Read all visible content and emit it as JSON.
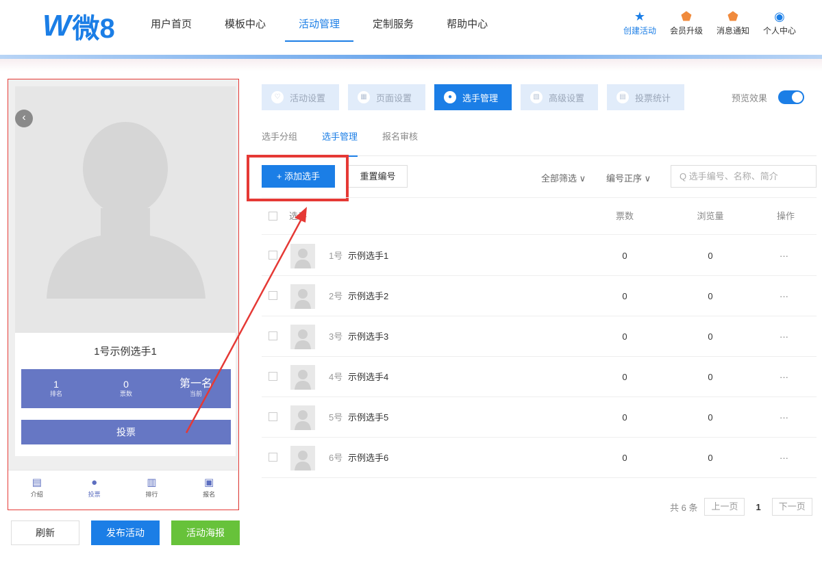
{
  "header": {
    "logo_w": "W",
    "logo_text": "微8",
    "nav": [
      {
        "label": "用户首页"
      },
      {
        "label": "模板中心"
      },
      {
        "label": "活动管理",
        "active": true
      },
      {
        "label": "定制服务"
      },
      {
        "label": "帮助中心"
      }
    ],
    "right": [
      {
        "label": "创建活动",
        "icon": "star-icon"
      },
      {
        "label": "会员升级",
        "icon": "crown-badge-icon"
      },
      {
        "label": "消息通知",
        "icon": "bell-badge-icon"
      },
      {
        "label": "个人中心",
        "icon": "user-circle-icon"
      }
    ]
  },
  "preview": {
    "player_name": "1号示例选手1",
    "stats": [
      {
        "value": "1",
        "label": "排名"
      },
      {
        "value": "0",
        "label": "票数"
      },
      {
        "value": "第一名",
        "label": "当前"
      }
    ],
    "vote_label": "投票",
    "tabs": [
      {
        "label": "介绍",
        "icon": "doc-icon"
      },
      {
        "label": "投票",
        "icon": "person-icon"
      },
      {
        "label": "排行",
        "icon": "bar-chart-icon"
      },
      {
        "label": "报名",
        "icon": "id-card-icon"
      }
    ]
  },
  "bottom_buttons": {
    "refresh": "刷新",
    "publish": "发布活动",
    "poster": "活动海报"
  },
  "steps": [
    {
      "label": "活动设置"
    },
    {
      "label": "页面设置"
    },
    {
      "label": "选手管理",
      "active": true
    },
    {
      "label": "高级设置"
    },
    {
      "label": "投票统计"
    }
  ],
  "preview_effect_label": "预览效果",
  "subtabs": [
    {
      "label": "选手分组"
    },
    {
      "label": "选手管理",
      "active": true
    },
    {
      "label": "报名审核"
    }
  ],
  "toolbar": {
    "add_label": "+ 添加选手",
    "renumber_label": "重置编号",
    "filter_all": "全部筛选 ∨",
    "sort_label": "编号正序 ∨",
    "search_placeholder": "Q 选手编号、名称、简介"
  },
  "table": {
    "headers": {
      "player": "选手",
      "votes": "票数",
      "views": "浏览量",
      "actions": "操作"
    },
    "rows": [
      {
        "no": "1号",
        "name": "示例选手1",
        "votes": "0",
        "views": "0",
        "more": "···"
      },
      {
        "no": "2号",
        "name": "示例选手2",
        "votes": "0",
        "views": "0",
        "more": "···"
      },
      {
        "no": "3号",
        "name": "示例选手3",
        "votes": "0",
        "views": "0",
        "more": "···"
      },
      {
        "no": "4号",
        "name": "示例选手4",
        "votes": "0",
        "views": "0",
        "more": "···"
      },
      {
        "no": "5号",
        "name": "示例选手5",
        "votes": "0",
        "views": "0",
        "more": "···"
      },
      {
        "no": "6号",
        "name": "示例选手6",
        "votes": "0",
        "views": "0",
        "more": "···"
      }
    ]
  },
  "pagination": {
    "total": "共 6 条",
    "prev": "上一页",
    "current": "1",
    "next": "下一页"
  },
  "colors": {
    "primary": "#1b7ee6",
    "preview_accent": "#6677c4",
    "highlight": "#e53935",
    "poster_green": "#67c23a"
  }
}
